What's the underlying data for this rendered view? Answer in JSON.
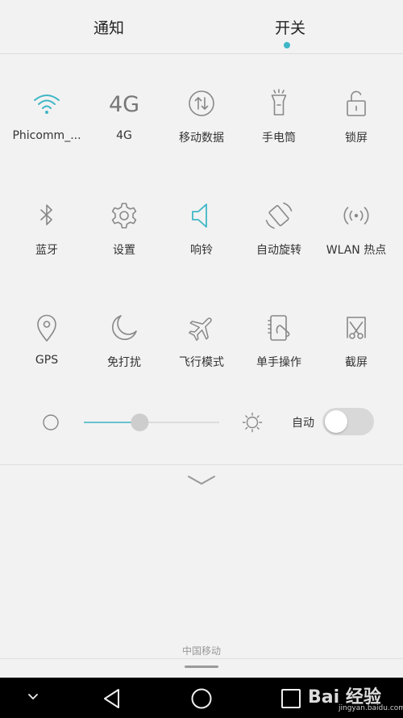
{
  "tabs": [
    {
      "label": "通知"
    },
    {
      "label": "开关",
      "active": true
    }
  ],
  "accent_color": "#3fb6c6",
  "tiles": [
    {
      "label": "Phicomm_...",
      "icon": "wifi-icon",
      "active": true
    },
    {
      "label": "4G",
      "icon": "4g-icon",
      "icon_text": "4G",
      "active": false
    },
    {
      "label": "移动数据",
      "icon": "mobile-data-icon",
      "active": false
    },
    {
      "label": "手电筒",
      "icon": "flashlight-icon",
      "active": false
    },
    {
      "label": "锁屏",
      "icon": "lock-icon",
      "active": false
    },
    {
      "label": "蓝牙",
      "icon": "bluetooth-icon",
      "active": false
    },
    {
      "label": "设置",
      "icon": "settings-icon",
      "active": false
    },
    {
      "label": "响铃",
      "icon": "ringer-icon",
      "active": true
    },
    {
      "label": "自动旋转",
      "icon": "auto-rotate-icon",
      "active": false
    },
    {
      "label": "WLAN 热点",
      "icon": "hotspot-icon",
      "active": false
    },
    {
      "label": "GPS",
      "icon": "gps-icon",
      "active": false
    },
    {
      "label": "免打扰",
      "icon": "moon-icon",
      "active": false
    },
    {
      "label": "飞行模式",
      "icon": "airplane-icon",
      "active": false
    },
    {
      "label": "单手操作",
      "icon": "one-hand-icon",
      "active": false
    },
    {
      "label": "截屏",
      "icon": "screenshot-icon",
      "active": false
    }
  ],
  "brightness": {
    "level": 0.4,
    "auto_label": "自动",
    "auto_on": false
  },
  "carrier": "中国移动",
  "watermark": {
    "text": "Bai 经验",
    "url": "jingyan.baidu.com"
  }
}
